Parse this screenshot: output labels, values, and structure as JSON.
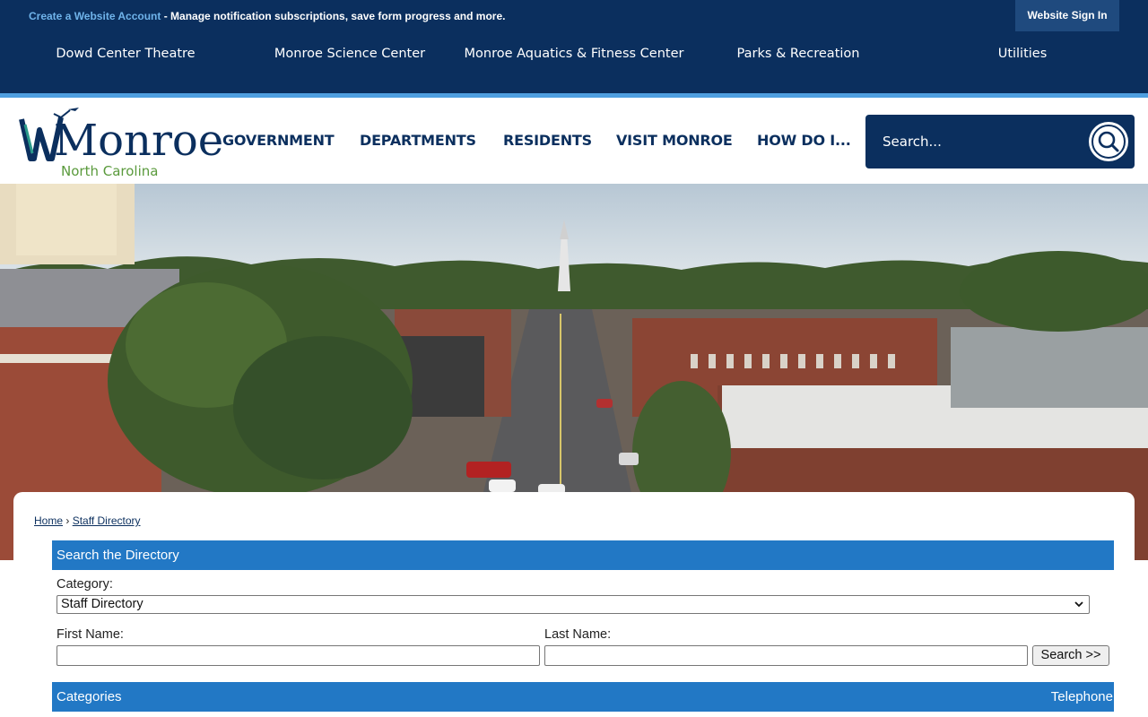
{
  "topbar": {
    "create_account_link": "Create a Website Account",
    "create_account_desc": " - Manage notification subscriptions, save form progress and more.",
    "sign_in": "Website Sign In"
  },
  "quick_links": [
    "Dowd Center Theatre",
    "Monroe Science Center",
    "Monroe Aquatics & Fitness Center",
    "Parks & Recreation",
    "Utilities"
  ],
  "logo": {
    "word": "Monroe",
    "subtitle": "North Carolina"
  },
  "main_nav": [
    "GOVERNMENT",
    "DEPARTMENTS",
    "RESIDENTS",
    "VISIT MONROE",
    "HOW DO I..."
  ],
  "search": {
    "placeholder": "Search..."
  },
  "breadcrumb": {
    "home": "Home",
    "separator": "›",
    "current": "Staff Directory"
  },
  "directory": {
    "heading": "Search the Directory",
    "category_label": "Category:",
    "category_selected": "Staff Directory",
    "first_name_label": "First Name:",
    "last_name_label": "Last Name:",
    "search_button": "Search >>"
  },
  "table": {
    "col_categories": "Categories",
    "col_telephone": "Telephone"
  },
  "colors": {
    "navy": "#0b2f5e",
    "accent_blue": "#2278c5",
    "stripe_blue": "#4f9fe0",
    "logo_green": "#5a9a3c"
  }
}
